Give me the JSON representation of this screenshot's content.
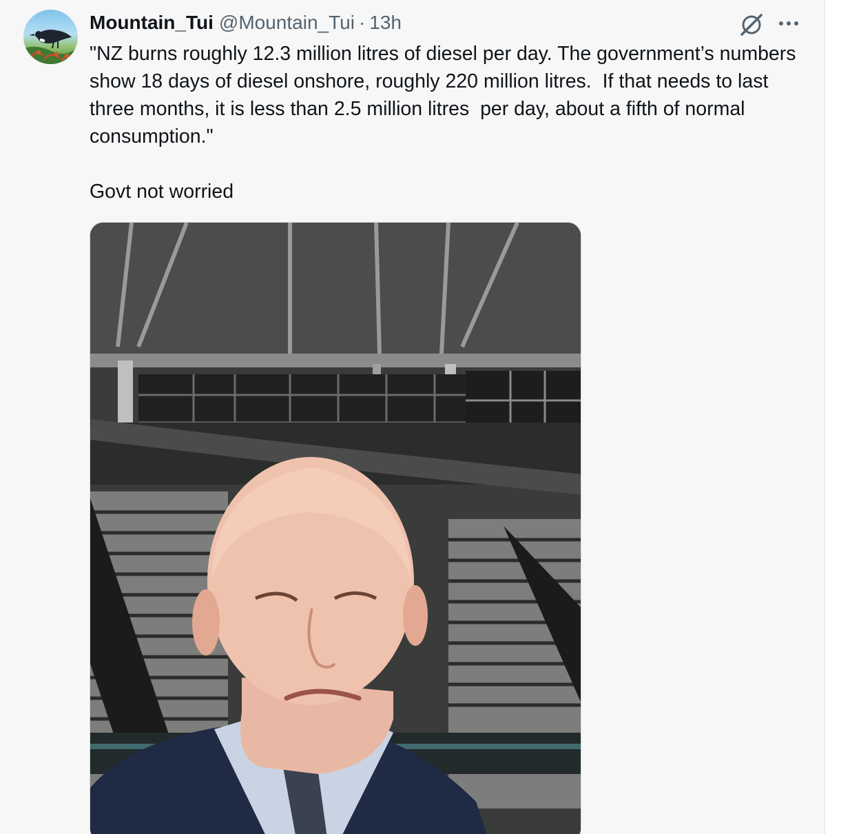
{
  "tweet": {
    "author": {
      "display_name": "Mountain_Tui",
      "handle": "@Mountain_Tui",
      "separator": "·",
      "timestamp": "13h"
    },
    "text": "\"NZ burns roughly 12.3 million litres of diesel per day. The government’s numbers show 18 days of diesel onshore, roughly 220 million litres.  If that needs to last three months, it is less than 2.5 million litres  per day, about a fifth of normal consumption.\"\n\nGovt not worried",
    "icons": {
      "avatar": "tui-bird-avatar",
      "grok": "grok-icon",
      "more": "more-icon"
    },
    "media": {
      "type": "video-still",
      "subject": "bald man in suit and tie",
      "background": "empty stadium stands"
    }
  },
  "colors": {
    "background": "#f7f7f7",
    "text_primary": "#0f1419",
    "text_secondary": "#536471"
  }
}
